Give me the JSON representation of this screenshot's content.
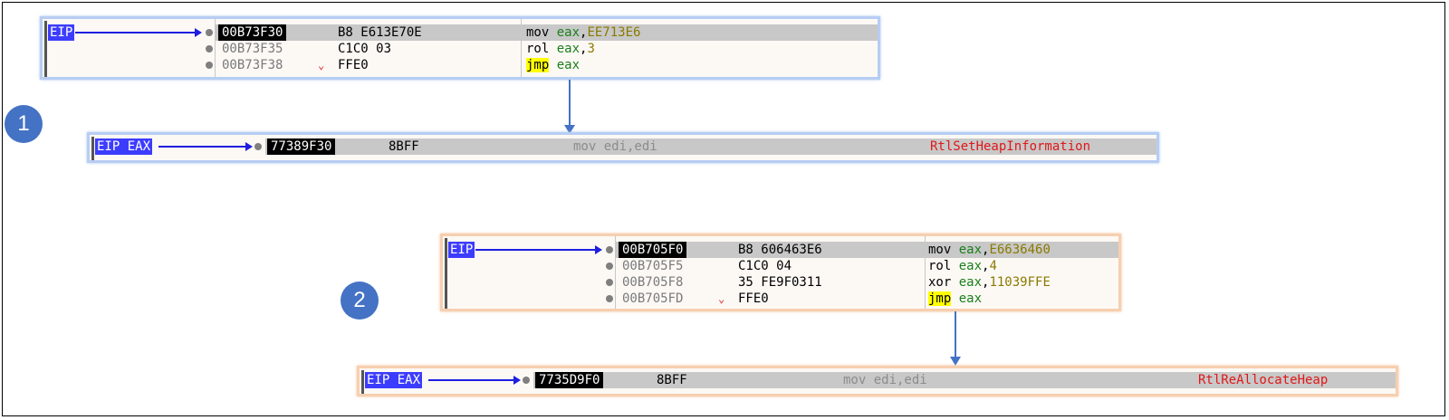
{
  "step1": {
    "badge": "1",
    "panel_top": {
      "eip_label": "EIP",
      "rows": [
        {
          "addr": "00B73F30",
          "bytes": "B8 E613E70E",
          "mnem": "mov ",
          "reg": "eax",
          "punct": ",",
          "imm": "EE713E6"
        },
        {
          "addr": "00B73F35",
          "bytes": "C1C0 03",
          "mnem": "rol ",
          "reg": "eax",
          "punct": ",",
          "imm": "3"
        },
        {
          "addr": "00B73F38",
          "tick": "⌄",
          "bytes": "FFE0",
          "jmp": "jmp",
          "reg": "eax"
        }
      ]
    },
    "panel_bottom": {
      "eip_label": "EIP EAX",
      "addr": "77389F30",
      "bytes": "8BFF",
      "instr": "mov edi,edi",
      "fn": "RtlSetHeapInformation"
    }
  },
  "step2": {
    "badge": "2",
    "panel_top": {
      "eip_label": "EIP",
      "rows": [
        {
          "addr": "00B705F0",
          "bytes": "B8 606463E6",
          "mnem": "mov ",
          "reg": "eax",
          "punct": ",",
          "imm": "E6636460"
        },
        {
          "addr": "00B705F5",
          "bytes": "C1C0 04",
          "mnem": "rol ",
          "reg": "eax",
          "punct": ",",
          "imm": "4"
        },
        {
          "addr": "00B705F8",
          "bytes": "35 FE9F0311",
          "mnem": "xor ",
          "reg": "eax",
          "punct": ",",
          "imm": "11039FFE"
        },
        {
          "addr": "00B705FD",
          "tick": "⌄",
          "bytes": "FFE0",
          "jmp": "jmp",
          "reg": "eax"
        }
      ]
    },
    "panel_bottom": {
      "eip_label": "EIP EAX",
      "addr": "7735D9F0",
      "bytes": "8BFF",
      "instr": "mov edi,edi",
      "fn": "RtlReAllocateHeap"
    }
  },
  "colors": {
    "blue_border": "#b7cdf2",
    "orange_border": "#f6cfb0",
    "eip_bg": "#3c3cff",
    "arrow": "#4472c4",
    "function": "#e01818"
  }
}
